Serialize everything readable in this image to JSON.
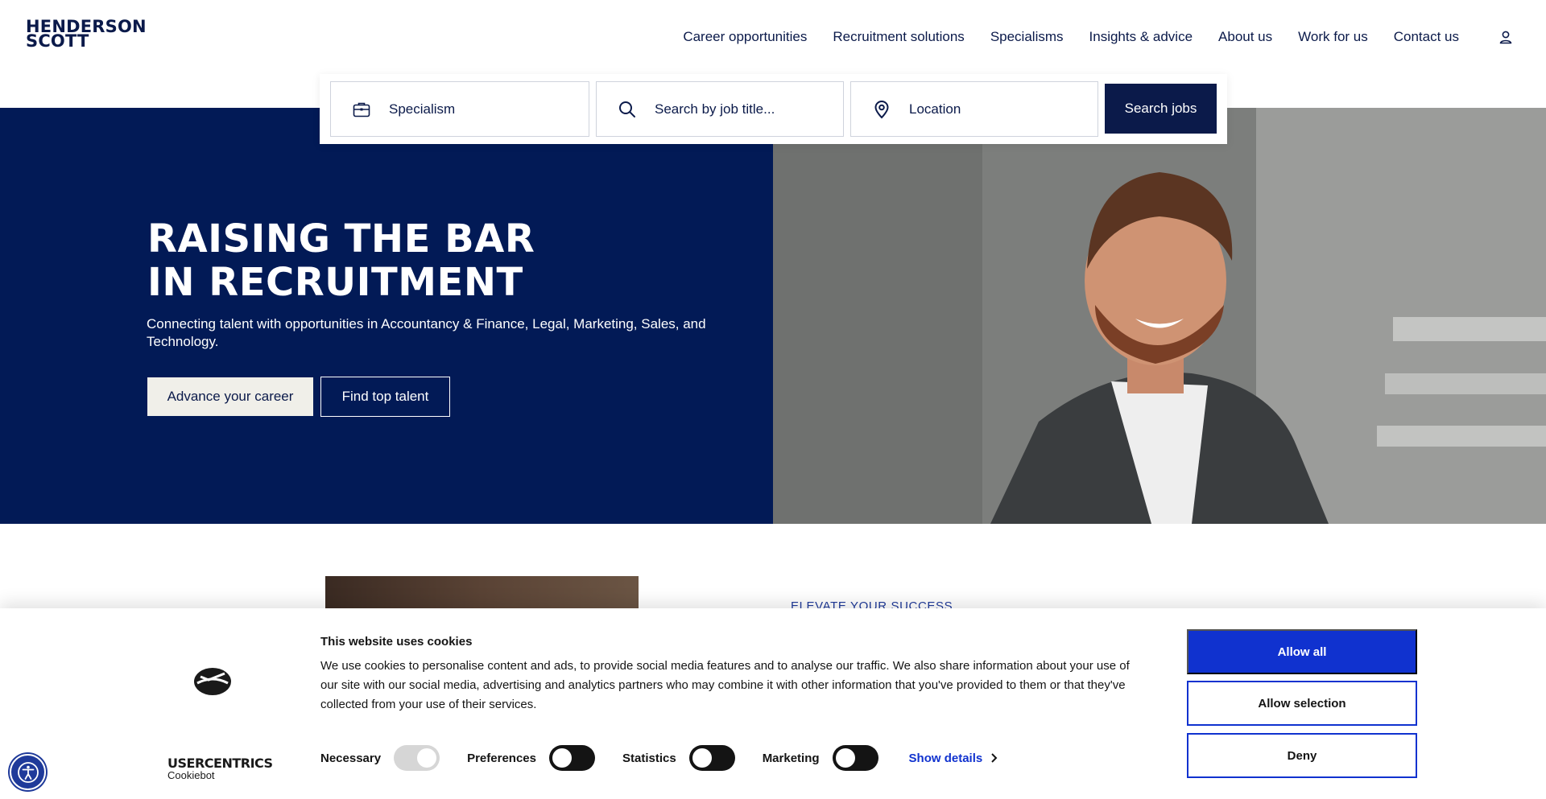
{
  "brand": {
    "line1": "HENDERSON",
    "line2": "SCOTT"
  },
  "nav": {
    "items": [
      {
        "label": "Career opportunities"
      },
      {
        "label": "Recruitment solutions"
      },
      {
        "label": "Specialisms"
      },
      {
        "label": "Insights & advice"
      },
      {
        "label": "About us"
      },
      {
        "label": "Work for us"
      },
      {
        "label": "Contact us"
      }
    ],
    "account_icon": "user-icon"
  },
  "search": {
    "specialism_label": "Specialism",
    "job_placeholder": "Search by job title...",
    "location_placeholder": "Location",
    "submit_label": "Search jobs"
  },
  "hero": {
    "title_line1": "RAISING THE BAR",
    "title_line2": "IN RECRUITMENT",
    "subtitle": "Connecting talent with opportunities in Accountancy & Finance, Legal, Marketing, Sales, and Technology.",
    "primary_cta": "Advance your career",
    "secondary_cta": "Find top talent"
  },
  "section": {
    "eyebrow": "ELEVATE YOUR SUCCESS"
  },
  "cookie": {
    "title": "This website uses cookies",
    "text": "We use cookies to personalise content and ads, to provide social media features and to analyse our traffic. We also share information about your use of our site with our social media, advertising and analytics partners who may combine it with other information that you've provided to them or that they've collected from your use of their services.",
    "brand": "USERCENTRICS",
    "brand_sub": "Cookiebot",
    "toggles": [
      {
        "label": "Necessary"
      },
      {
        "label": "Preferences"
      },
      {
        "label": "Statistics"
      },
      {
        "label": "Marketing"
      }
    ],
    "show_details": "Show details",
    "allow_all": "Allow all",
    "allow_selection": "Allow selection",
    "deny": "Deny"
  },
  "colors": {
    "navy": "#021a56",
    "cookie_blue": "#1032cf"
  }
}
